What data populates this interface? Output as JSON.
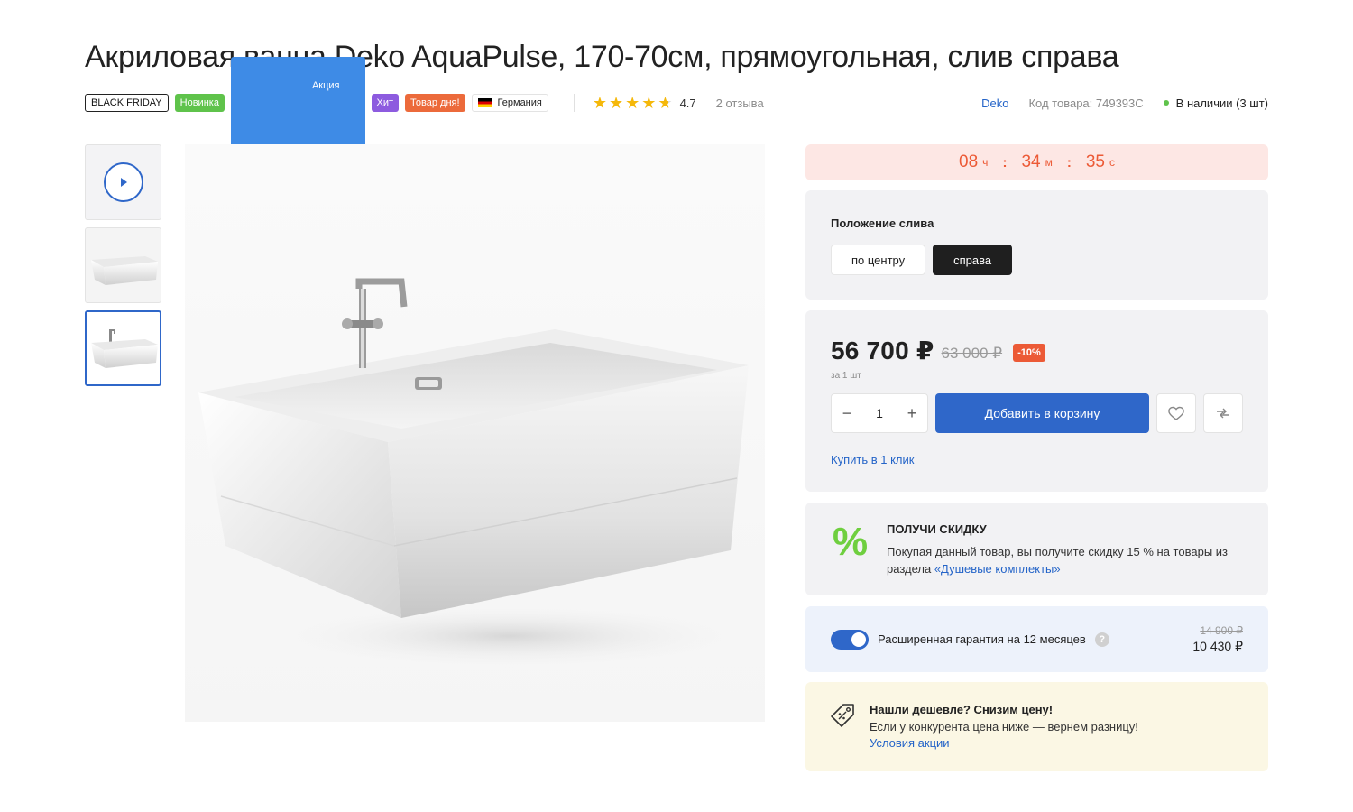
{
  "product": {
    "title": "Акриловая ванна Deko AquaPulse, 170-70см, прямоугольная, слив справа",
    "badges": [
      "BLACK FRIDAY",
      "Новинка",
      "Акция",
      "Хит",
      "Товар дня!"
    ],
    "country": "Германия",
    "rating": "4.7",
    "rating_stars": 4.7,
    "reviews": "2 отзыва",
    "brand": "Deko",
    "sku": "Код товара: 749393C",
    "stock": "В наличии (3 шт)"
  },
  "timer": {
    "hours": "08",
    "hours_unit": "ч",
    "minutes": "34",
    "minutes_unit": "м",
    "seconds": "35",
    "seconds_unit": "с"
  },
  "drain": {
    "label": "Положение слива",
    "options": [
      "по центру",
      "справа"
    ],
    "selected": "справа"
  },
  "buy": {
    "price": "56 700 ₽",
    "old_price": "63 000 ₽",
    "discount": "-10%",
    "per_unit": "за 1 шт",
    "qty": "1",
    "add_to_cart": "Добавить в корзину",
    "one_click": "Купить в 1 клик"
  },
  "promo": {
    "title": "ПОЛУЧИ СКИДКУ",
    "text": "Покупая данный товар, вы получите скидку 15 % на товары из раздела ",
    "link": "«Душевые комплекты»"
  },
  "warranty": {
    "enabled": true,
    "text": "Расширенная гарантия на 12 месяцев",
    "old_price": "14 900 ₽",
    "price": "10 430 ₽"
  },
  "cheaper": {
    "title": "Нашли дешевле? Снизим цену!",
    "text": "Если у конкурента цена ниже — вернем разницу!",
    "link": "Условия акции"
  },
  "colors": {
    "accent": "#2f67c9",
    "sale": "#ec5a36",
    "green": "#5fc34b"
  }
}
